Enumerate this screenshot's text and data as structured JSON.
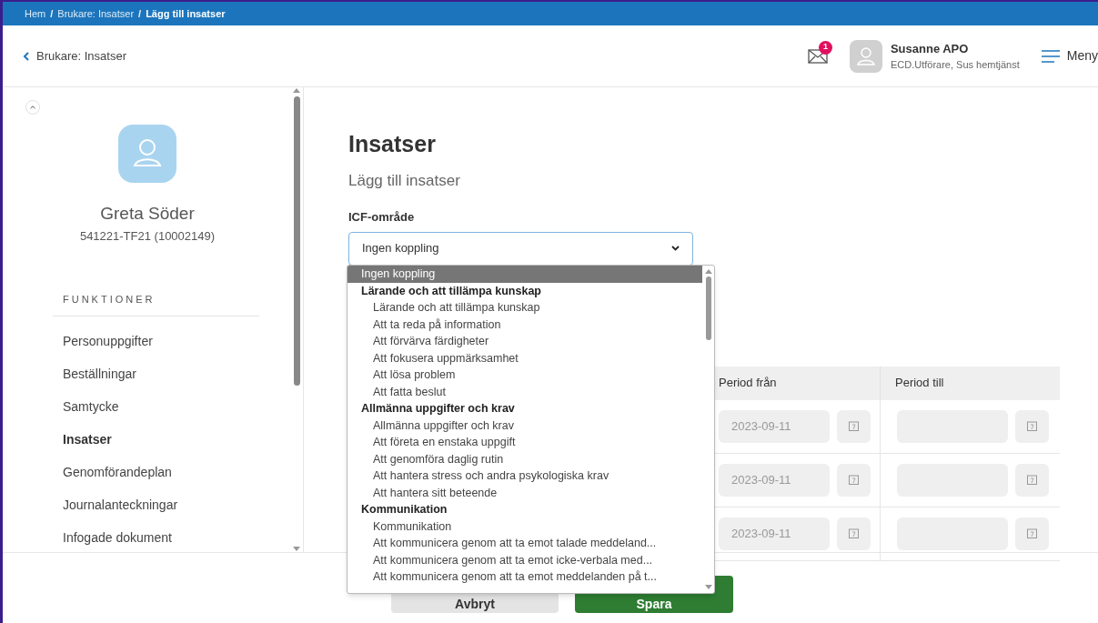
{
  "breadcrumb_separator": "/",
  "breadcrumb": [
    {
      "label": "Hem",
      "current": false
    },
    {
      "label": "Brukare: Insatser",
      "current": false
    },
    {
      "label": "Lägg till insatser",
      "current": true
    }
  ],
  "header": {
    "back": "Brukare: Insatser",
    "messages_badge": "1",
    "user_name": "Susanne APO",
    "user_role": "ECD.Utförare, Sus hemtjänst",
    "menu": "Meny"
  },
  "client": {
    "name": "Greta Söder",
    "id": "541221-TF21 (10002149)"
  },
  "sidebar": {
    "heading": "FUNKTIONER",
    "items": [
      {
        "label": "Personuppgifter",
        "selected": false
      },
      {
        "label": "Beställningar",
        "selected": false
      },
      {
        "label": "Samtycke",
        "selected": false
      },
      {
        "label": "Insatser",
        "selected": true
      },
      {
        "label": "Genomförandeplan",
        "selected": false
      },
      {
        "label": "Journalanteckningar",
        "selected": false
      },
      {
        "label": "Infogade dokument",
        "selected": false
      }
    ]
  },
  "page": {
    "title": "Insatser",
    "subtitle": "Lägg till insatser",
    "field_label": "ICF-område",
    "select_value": "Ingen koppling"
  },
  "dropdown": [
    {
      "kind": "option",
      "label": "Ingen koppling",
      "selected": true
    },
    {
      "kind": "group",
      "label": "Lärande och att tillämpa kunskap",
      "selected": false
    },
    {
      "kind": "child",
      "label": "Lärande och att tillämpa kunskap",
      "selected": false
    },
    {
      "kind": "child",
      "label": "Att ta reda på information",
      "selected": false
    },
    {
      "kind": "child",
      "label": "Att förvärva färdigheter",
      "selected": false
    },
    {
      "kind": "child",
      "label": "Att fokusera uppmärksamhet",
      "selected": false
    },
    {
      "kind": "child",
      "label": "Att lösa problem",
      "selected": false
    },
    {
      "kind": "child",
      "label": "Att fatta beslut",
      "selected": false
    },
    {
      "kind": "group",
      "label": "Allmänna uppgifter och krav",
      "selected": false
    },
    {
      "kind": "child",
      "label": "Allmänna uppgifter och krav",
      "selected": false
    },
    {
      "kind": "child",
      "label": "Att företa en enstaka uppgift",
      "selected": false
    },
    {
      "kind": "child",
      "label": "Att genomföra daglig rutin",
      "selected": false
    },
    {
      "kind": "child",
      "label": "Att hantera stress och andra psykologiska krav",
      "selected": false
    },
    {
      "kind": "child",
      "label": "Att hantera sitt beteende",
      "selected": false
    },
    {
      "kind": "group",
      "label": "Kommunikation",
      "selected": false
    },
    {
      "kind": "child",
      "label": "Kommunikation",
      "selected": false
    },
    {
      "kind": "child",
      "label": "Att kommunicera genom att ta emot talade meddeland...",
      "selected": false
    },
    {
      "kind": "child",
      "label": "Att kommunicera genom att ta emot icke-verbala med...",
      "selected": false
    },
    {
      "kind": "child",
      "label": "Att kommunicera genom att ta emot meddelanden på t...",
      "selected": false
    }
  ],
  "table": {
    "columns": [
      "Period från",
      "Period till"
    ],
    "rows": [
      {
        "period_from": "2023-09-11"
      },
      {
        "period_from": "2023-09-11"
      },
      {
        "period_from": "2023-09-11"
      }
    ]
  },
  "buttons": {
    "cancel": "Avbryt",
    "save": "Spara"
  }
}
